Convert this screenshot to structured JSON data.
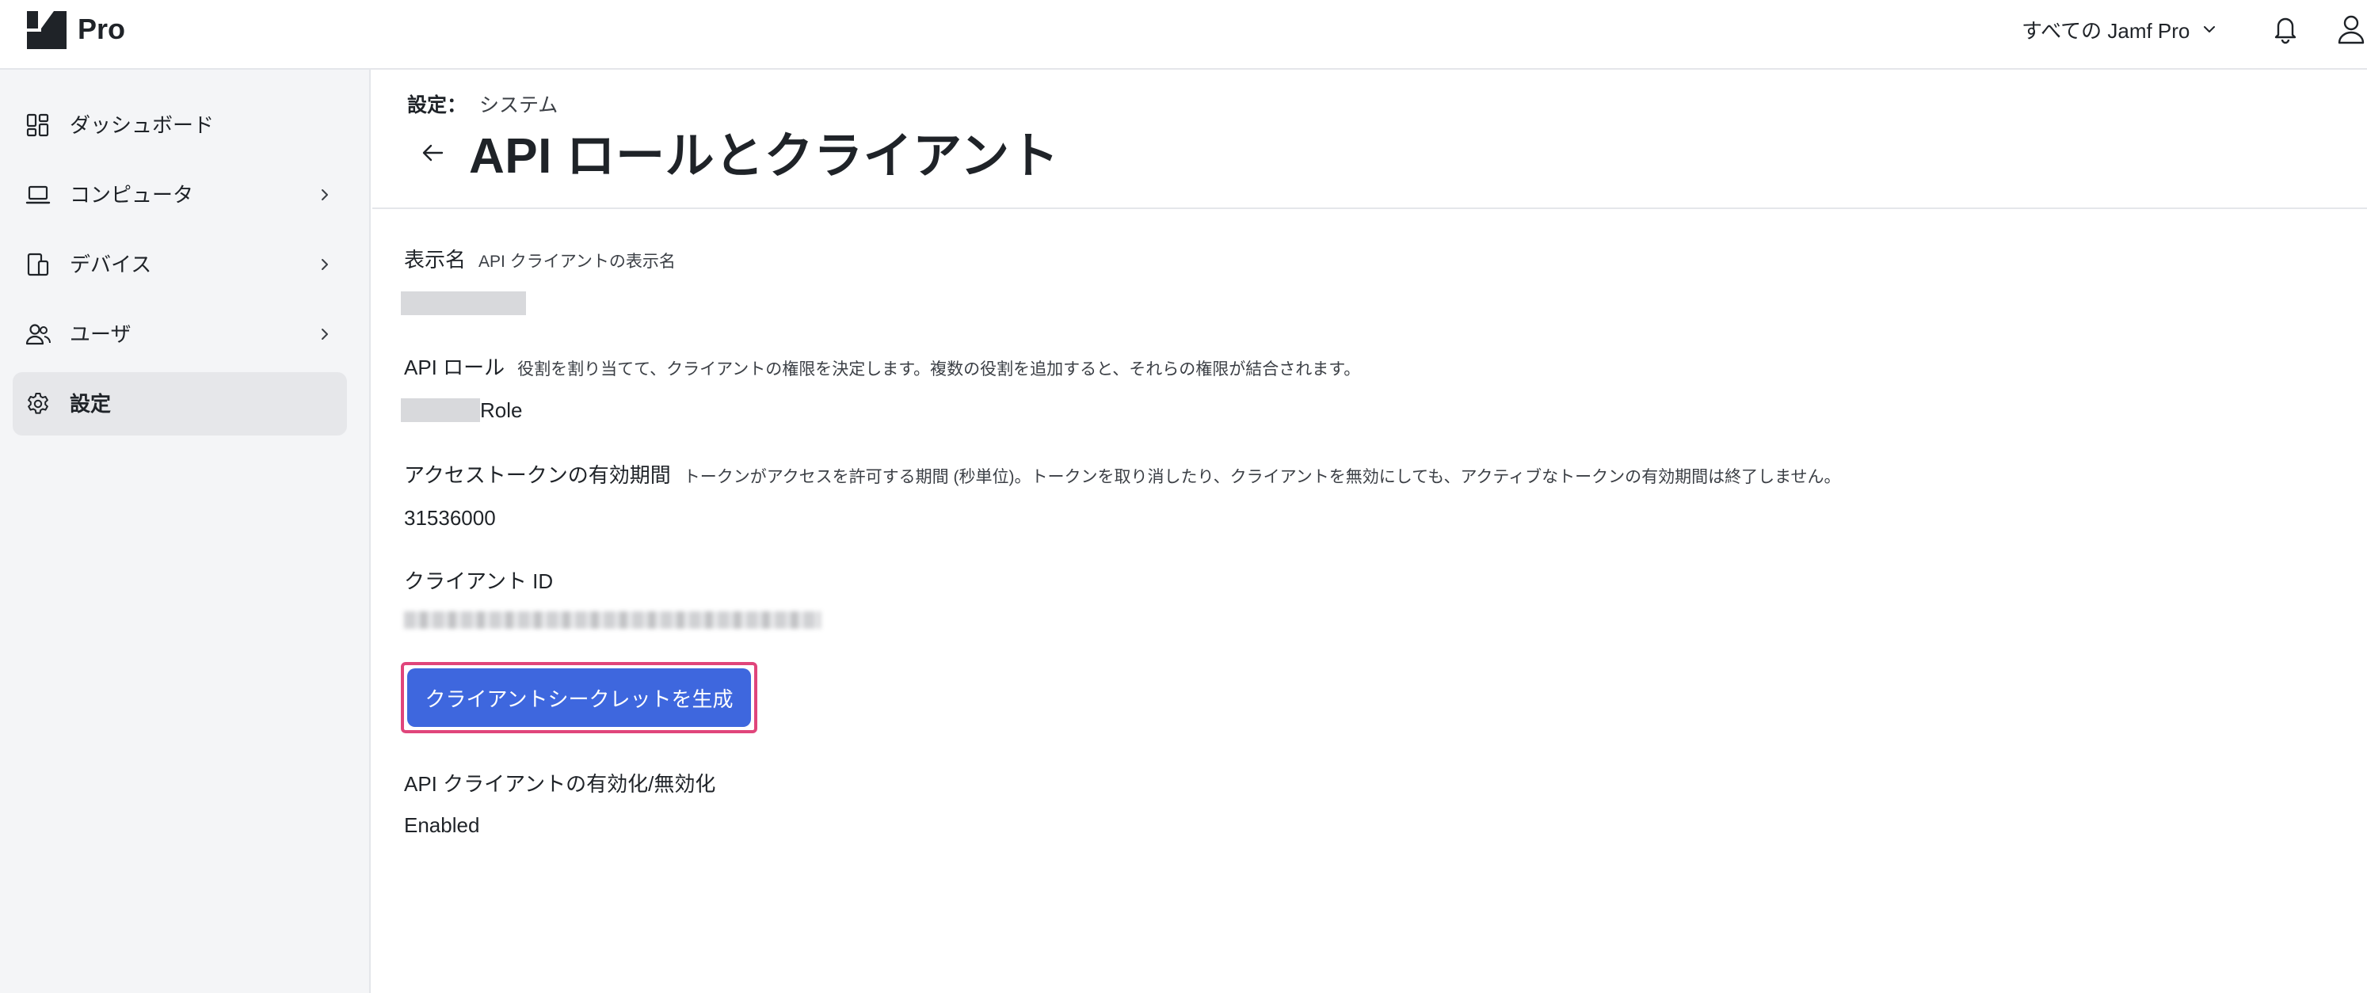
{
  "header": {
    "brand": "Pro",
    "scope_label": "すべての Jamf Pro"
  },
  "sidebar": {
    "items": [
      {
        "label": "ダッシュボード",
        "icon": "dashboard-icon",
        "has_children": false,
        "active": false
      },
      {
        "label": "コンピュータ",
        "icon": "laptop-icon",
        "has_children": true,
        "active": false
      },
      {
        "label": "デバイス",
        "icon": "devices-icon",
        "has_children": true,
        "active": false
      },
      {
        "label": "ユーザ",
        "icon": "users-icon",
        "has_children": true,
        "active": false
      },
      {
        "label": "設定",
        "icon": "gear-icon",
        "has_children": false,
        "active": true
      }
    ]
  },
  "breadcrumb": {
    "prefix": "設定：",
    "section": "システム"
  },
  "page": {
    "title": "API ロールとクライアント"
  },
  "form": {
    "display_name": {
      "label": "表示名",
      "help": "API クライアントの表示名"
    },
    "api_roles": {
      "label": "API ロール",
      "help": "役割を割り当てて、クライアントの権限を決定します。複数の役割を追加すると、それらの権限が結合されます。",
      "value_suffix": "Role"
    },
    "token_lifetime": {
      "label": "アクセストークンの有効期間",
      "help": "トークンがアクセスを許可する期間 (秒単位)。トークンを取り消したり、クライアントを無効にしても、アクティブなトークンの有効期間は終了しません。",
      "value": "31536000"
    },
    "client_id": {
      "label": "クライアント ID"
    },
    "generate_button": {
      "label": "クライアントシークレットを生成"
    },
    "enable": {
      "label": "API クライアントの有効化/無効化",
      "value": "Enabled"
    }
  },
  "colors": {
    "primary": "#3e67de",
    "highlight": "#e0457b",
    "sidebar_bg": "#f4f5f7",
    "active_item_bg": "#e6e7ea"
  }
}
